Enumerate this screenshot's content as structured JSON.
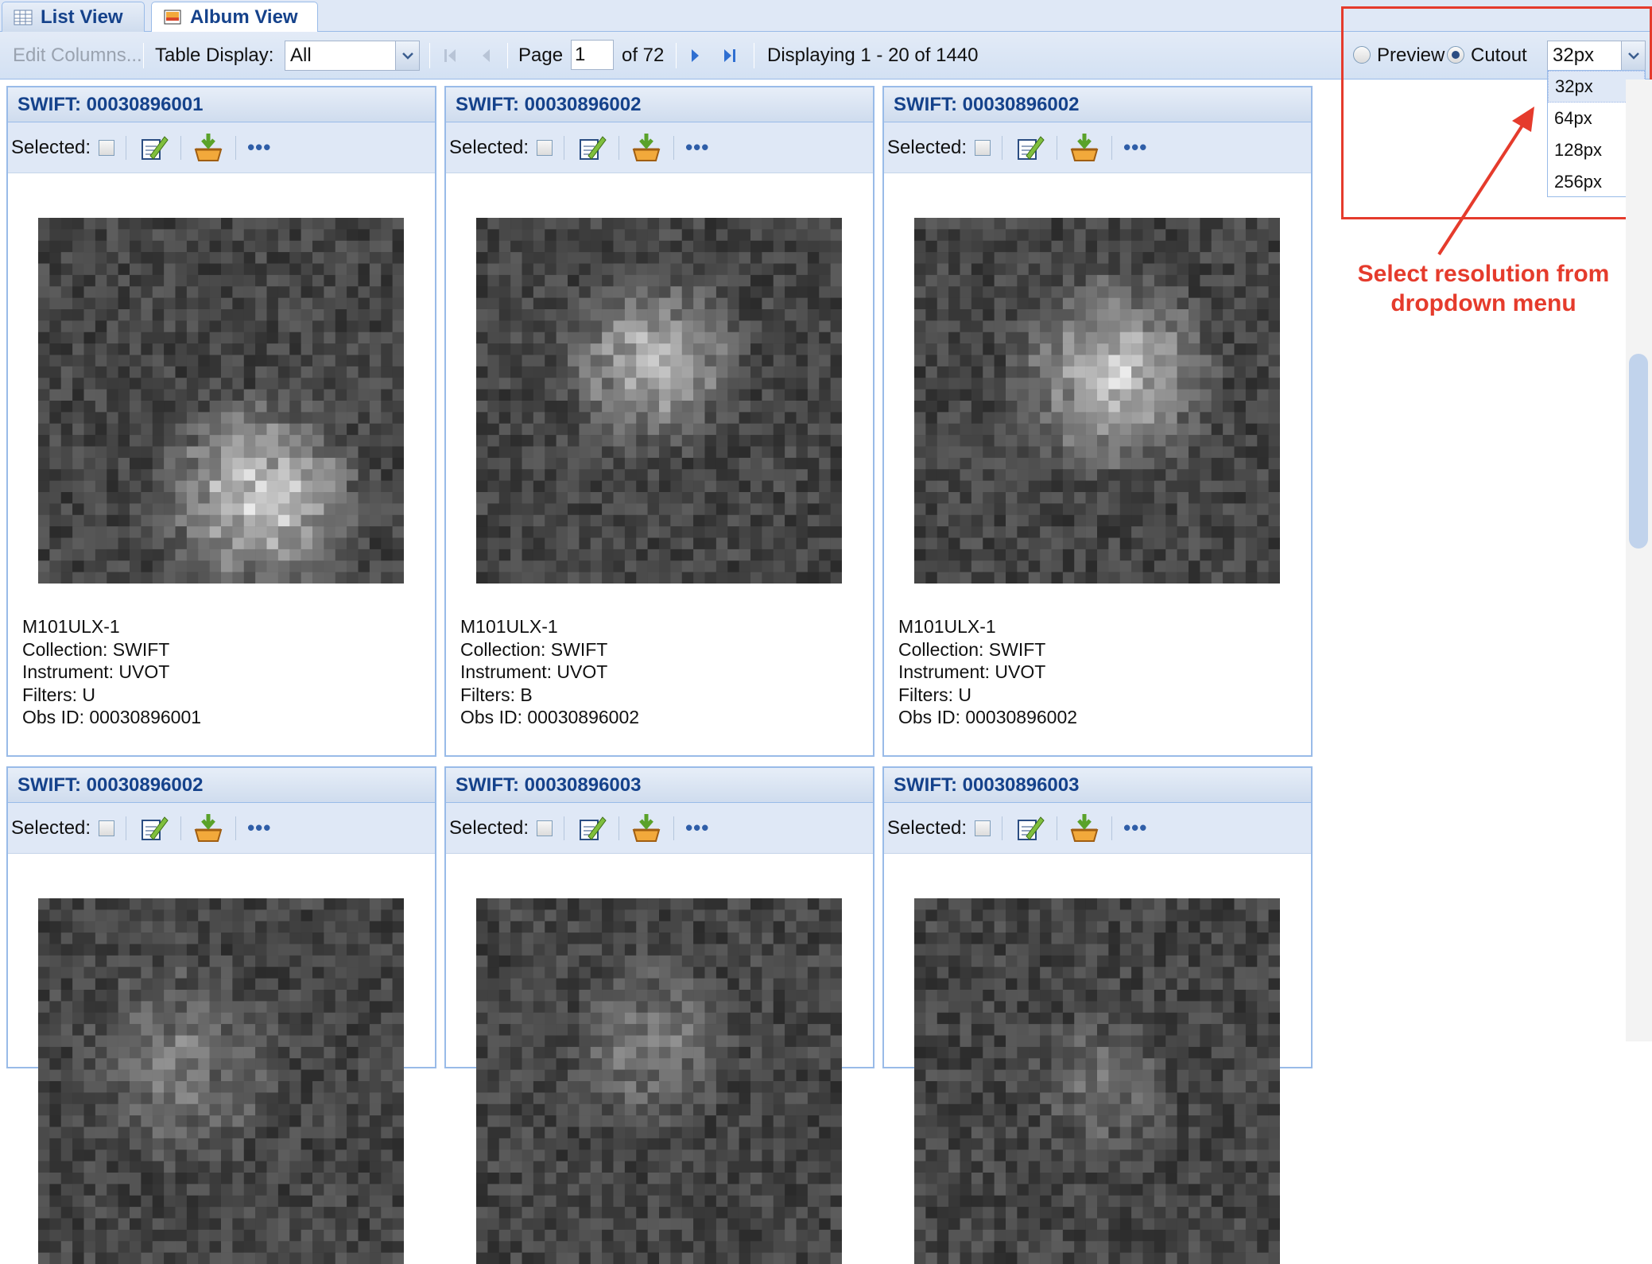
{
  "tabs": {
    "list_view": "List View",
    "album_view": "Album View"
  },
  "toolbar": {
    "edit_columns": "Edit Columns...",
    "table_display_label": "Table Display:",
    "table_display_value": "All",
    "page_label": "Page",
    "page_value": "1",
    "page_of": "of 72",
    "displaying": "Displaying 1 - 20 of 1440"
  },
  "view_mode": {
    "preview_label": "Preview",
    "cutout_label": "Cutout",
    "selected_mode": "Cutout",
    "resolution_value": "32px",
    "resolution_options": [
      "32px",
      "64px",
      "128px",
      "256px"
    ],
    "selected_option": "32px"
  },
  "annotation": {
    "line1": "Select resolution from",
    "line2": "dropdown menu",
    "color": "#e53b2c"
  },
  "card_labels": {
    "selected": "Selected:"
  },
  "cards": [
    {
      "title": "SWIFT: 00030896001",
      "target": "M101ULX-1",
      "collection": "Collection: SWIFT",
      "instrument": "Instrument: UVOT",
      "filters": "Filters: U",
      "obs_id": "Obs ID: 00030896001"
    },
    {
      "title": "SWIFT: 00030896002",
      "target": "M101ULX-1",
      "collection": "Collection: SWIFT",
      "instrument": "Instrument: UVOT",
      "filters": "Filters: B",
      "obs_id": "Obs ID: 00030896002"
    },
    {
      "title": "SWIFT: 00030896002",
      "target": "M101ULX-1",
      "collection": "Collection: SWIFT",
      "instrument": "Instrument: UVOT",
      "filters": "Filters: U",
      "obs_id": "Obs ID: 00030896002"
    },
    {
      "title": "SWIFT: 00030896002"
    },
    {
      "title": "SWIFT: 00030896003"
    },
    {
      "title": "SWIFT: 00030896003"
    }
  ],
  "colors": {
    "header_text": "#15428b",
    "border": "#99bbe8",
    "panel_bg": "#dfe8f6"
  }
}
